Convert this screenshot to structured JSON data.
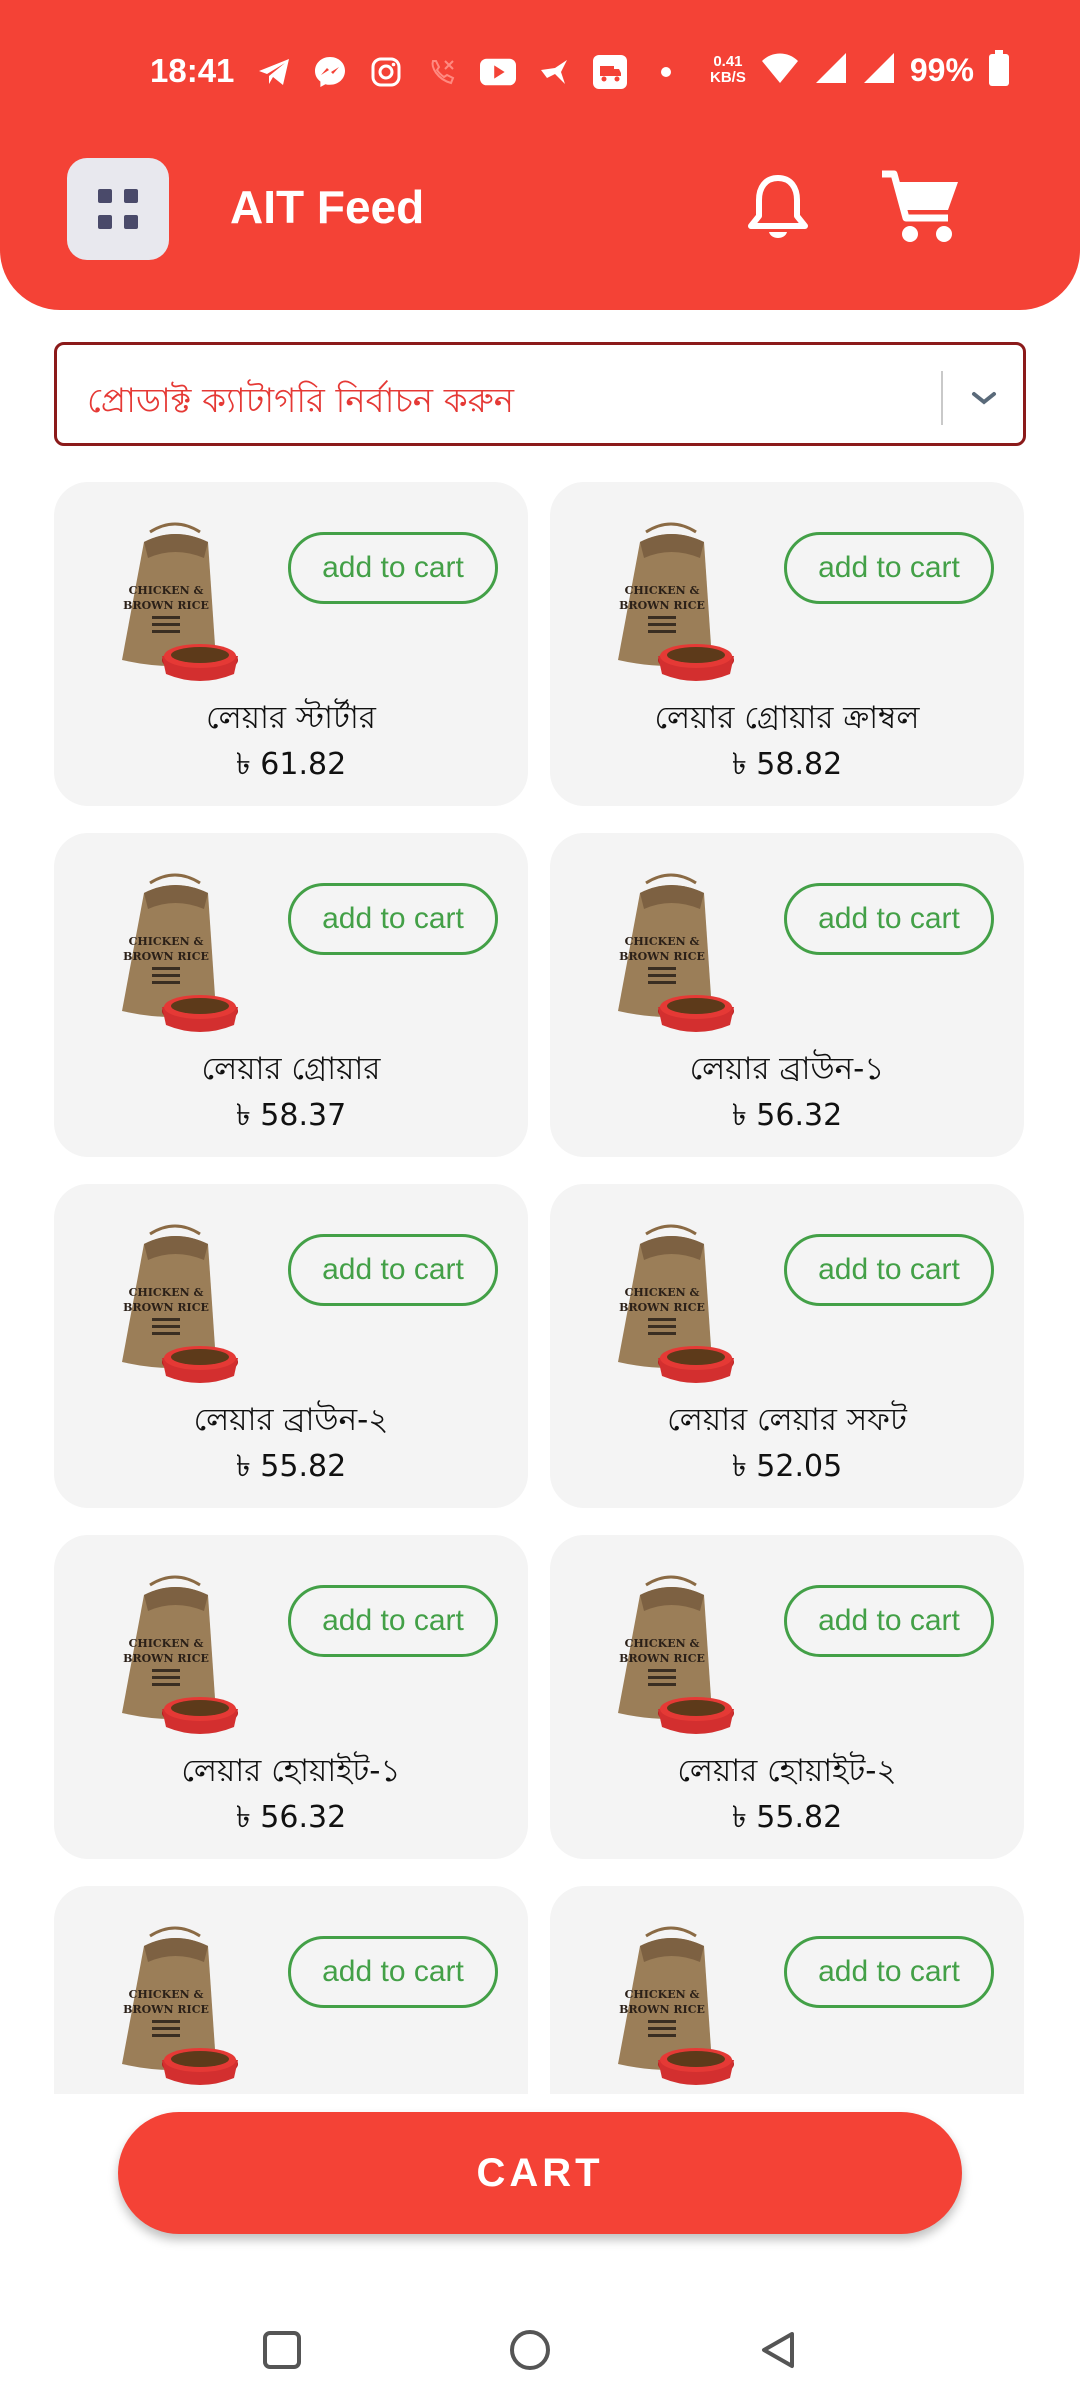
{
  "status_bar": {
    "time": "18:41",
    "net_speed_value": "0.41",
    "net_speed_unit": "KB/S",
    "battery": "99%",
    "icons": [
      "telegram-icon",
      "messenger-icon",
      "instagram-icon",
      "missed-call-icon",
      "youtube-icon",
      "bird-icon",
      "delivery-icon",
      "dot-icon",
      "wifi-icon",
      "signal-icon",
      "signal-icon",
      "battery-icon"
    ]
  },
  "header": {
    "title": "AIT Feed",
    "menu_icon": "grid-menu-icon",
    "notification_icon": "bell-icon",
    "cart_icon": "shopping-cart-icon"
  },
  "category_select": {
    "placeholder": "প্রোডাক্ট ক্যাটাগরি নির্বাচন করুন",
    "icon": "chevron-down-icon"
  },
  "products": [
    {
      "name": "লেয়ার স্টার্টার",
      "price": "৳ 61.82",
      "button": "add to cart"
    },
    {
      "name": "লেয়ার গ্রোয়ার ক্রাম্বল",
      "price": "৳ 58.82",
      "button": "add to cart"
    },
    {
      "name": "লেয়ার গ্রোয়ার",
      "price": "৳ 58.37",
      "button": "add to cart"
    },
    {
      "name": "লেয়ার ব্রাউন-১",
      "price": "৳ 56.32",
      "button": "add to cart"
    },
    {
      "name": "লেয়ার ব্রাউন-২",
      "price": "৳ 55.82",
      "button": "add to cart"
    },
    {
      "name": "লেয়ার লেয়ার সফট",
      "price": "৳ 52.05",
      "button": "add to cart"
    },
    {
      "name": "লেয়ার হোয়াইট-১",
      "price": "৳ 56.32",
      "button": "add to cart"
    },
    {
      "name": "লেয়ার হোয়াইট-২",
      "price": "৳ 55.82",
      "button": "add to cart"
    },
    {
      "name": "",
      "price": "",
      "button": "add to cart"
    },
    {
      "name": "",
      "price": "",
      "button": "add to cart"
    }
  ],
  "product_image_icon": "feed-sack-icon",
  "cart_button": "CART",
  "nav": [
    "recent-apps-icon",
    "home-icon",
    "back-icon"
  ],
  "colors": {
    "primary": "#f44236",
    "accent_green": "#43a047",
    "select_border": "#8b1a1a",
    "card_bg": "#f4f4f4"
  }
}
